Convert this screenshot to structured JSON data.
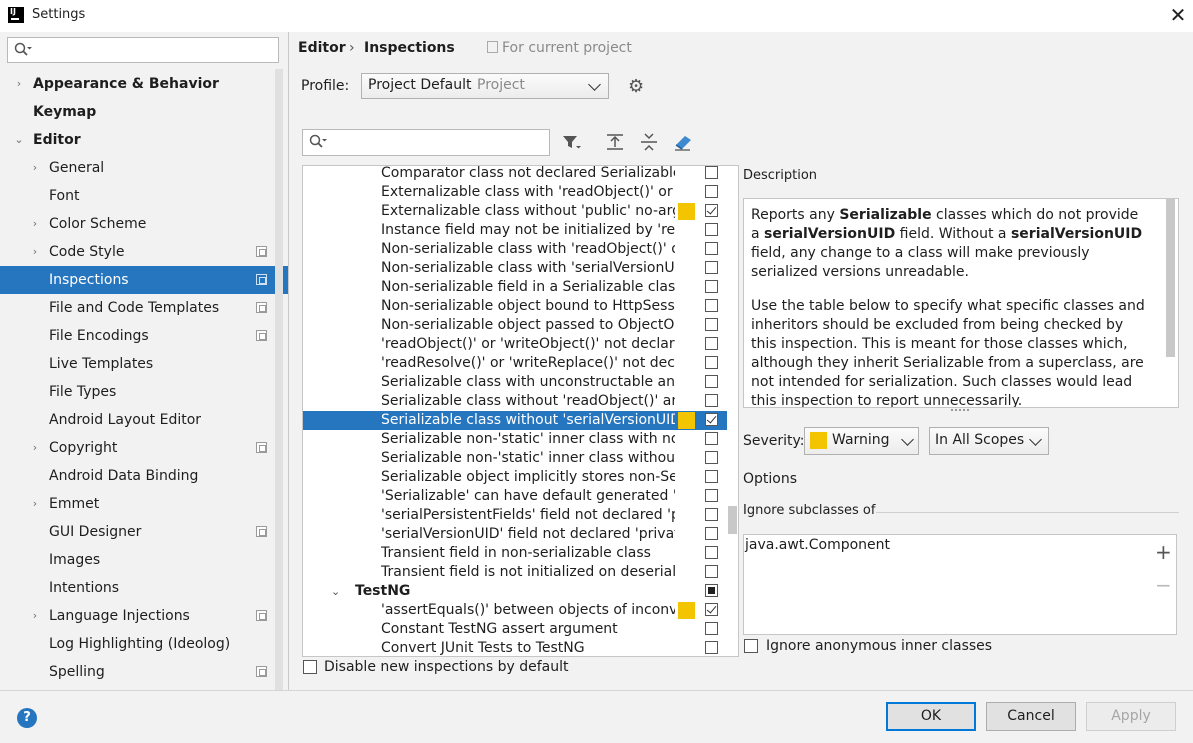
{
  "window": {
    "title": "Settings",
    "close": "✕",
    "app_icon_text": "IJ"
  },
  "sidebar": {
    "search_placeholder": "",
    "items": [
      {
        "label": "Appearance & Behavior",
        "arrow": "›",
        "bold": true,
        "level": 0
      },
      {
        "label": "Keymap",
        "bold": true,
        "level": 0
      },
      {
        "label": "Editor",
        "arrow": "⌄",
        "bold": true,
        "level": 0
      },
      {
        "label": "General",
        "arrow": "›",
        "level": 1
      },
      {
        "label": "Font",
        "level": 1
      },
      {
        "label": "Color Scheme",
        "arrow": "›",
        "level": 1
      },
      {
        "label": "Code Style",
        "arrow": "›",
        "level": 1,
        "project_icon": true
      },
      {
        "label": "Inspections",
        "level": 1,
        "project_icon": true,
        "selected": true
      },
      {
        "label": "File and Code Templates",
        "level": 1,
        "project_icon": true
      },
      {
        "label": "File Encodings",
        "level": 1,
        "project_icon": true
      },
      {
        "label": "Live Templates",
        "level": 1
      },
      {
        "label": "File Types",
        "level": 1
      },
      {
        "label": "Android Layout Editor",
        "level": 1
      },
      {
        "label": "Copyright",
        "arrow": "›",
        "level": 1,
        "project_icon": true
      },
      {
        "label": "Android Data Binding",
        "level": 1
      },
      {
        "label": "Emmet",
        "arrow": "›",
        "level": 1
      },
      {
        "label": "GUI Designer",
        "level": 1,
        "project_icon": true
      },
      {
        "label": "Images",
        "level": 1
      },
      {
        "label": "Intentions",
        "level": 1
      },
      {
        "label": "Language Injections",
        "arrow": "›",
        "level": 1,
        "project_icon": true
      },
      {
        "label": "Log Highlighting (Ideolog)",
        "level": 1
      },
      {
        "label": "Spelling",
        "level": 1,
        "project_icon": true
      }
    ]
  },
  "header": {
    "breadcrumb": [
      "Editor",
      "›",
      "Inspections"
    ],
    "for_current_project": "For current project",
    "profile_label": "Profile:",
    "profile_value": "Project Default",
    "profile_sub": "Project"
  },
  "inspections": {
    "rows": [
      {
        "text": "Comparator class not declared Serializable",
        "checked": false
      },
      {
        "text": "Externalizable class with 'readObject()' or 'writeObject()'",
        "checked": false
      },
      {
        "text": "Externalizable class without 'public' no-arg constructor",
        "checked": true,
        "severity": "#f2c500"
      },
      {
        "text": "Instance field may not be initialized by 'readObject()'",
        "checked": false
      },
      {
        "text": "Non-serializable class with 'readObject()' or 'writeObject()'",
        "checked": false
      },
      {
        "text": "Non-serializable class with 'serialVersionUID'",
        "checked": false
      },
      {
        "text": "Non-serializable field in a Serializable class",
        "checked": false
      },
      {
        "text": "Non-serializable object bound to HttpSession",
        "checked": false
      },
      {
        "text": "Non-serializable object passed to ObjectOutputStream",
        "checked": false
      },
      {
        "text": "'readObject()' or 'writeObject()' not declared 'private'",
        "checked": false
      },
      {
        "text": "'readResolve()' or 'writeReplace()' not declared 'protected'",
        "checked": false
      },
      {
        "text": "Serializable class with unconstructable ancestor",
        "checked": false
      },
      {
        "text": "Serializable class without 'readObject()' and 'writeObject()'",
        "checked": false
      },
      {
        "text": "Serializable class without 'serialVersionUID'",
        "checked": true,
        "severity": "#f2c500",
        "selected": true
      },
      {
        "text": "Serializable non-'static' inner class with non-Serializable outer class",
        "checked": false
      },
      {
        "text": "Serializable non-'static' inner class without 'serialVersionUID'",
        "checked": false
      },
      {
        "text": "Serializable object implicitly stores non-Serializable object",
        "checked": false
      },
      {
        "text": "'Serializable' can have default generated 'serialVersionUID'",
        "checked": false
      },
      {
        "text": "'serialPersistentFields' field not declared 'private static final ObjectStreamField[]'",
        "checked": false
      },
      {
        "text": "'serialVersionUID' field not declared 'private static final long'",
        "checked": false
      },
      {
        "text": "Transient field in non-serializable class",
        "checked": false
      },
      {
        "text": "Transient field is not initialized on deserialization",
        "checked": false
      },
      {
        "text": "TestNG",
        "group": true,
        "partial": true
      },
      {
        "text": "'assertEquals()' between objects of inconvertible types",
        "checked": true,
        "severity": "#f2c500"
      },
      {
        "text": "Constant TestNG assert argument",
        "checked": false
      },
      {
        "text": "Convert JUnit Tests to TestNG",
        "checked": false
      }
    ],
    "disable_new_label": "Disable new inspections by default"
  },
  "description": {
    "label": "Description",
    "p1": [
      {
        "t": "Reports any "
      },
      {
        "b": "Serializable"
      },
      {
        "t": " classes which do not provide a "
      },
      {
        "b": "serialVersionUID"
      },
      {
        "t": " field. Without a "
      },
      {
        "b": "serialVersionUID"
      },
      {
        "t": " field, any change to a class will make previously serialized versions unreadable."
      }
    ],
    "p2": "Use the table below to specify what specific classes and inheritors should be excluded from being checked by this inspection. This is meant for those classes which, although they inherit Serializable from a superclass, are not intended for serialization. Such classes would lead this inspection to report unnecessarily."
  },
  "severity": {
    "label": "Severity:",
    "value": "Warning",
    "color": "#f2c500",
    "scope": "In All Scopes"
  },
  "options": {
    "label": "Options",
    "ignore_subclasses_label": "Ignore subclasses of",
    "ignore_items": [
      "java.awt.Component"
    ],
    "plus": "+",
    "minus": "−",
    "anon_label": "Ignore anonymous inner classes"
  },
  "buttons": {
    "help": "?",
    "ok": "OK",
    "cancel": "Cancel",
    "apply": "Apply"
  }
}
